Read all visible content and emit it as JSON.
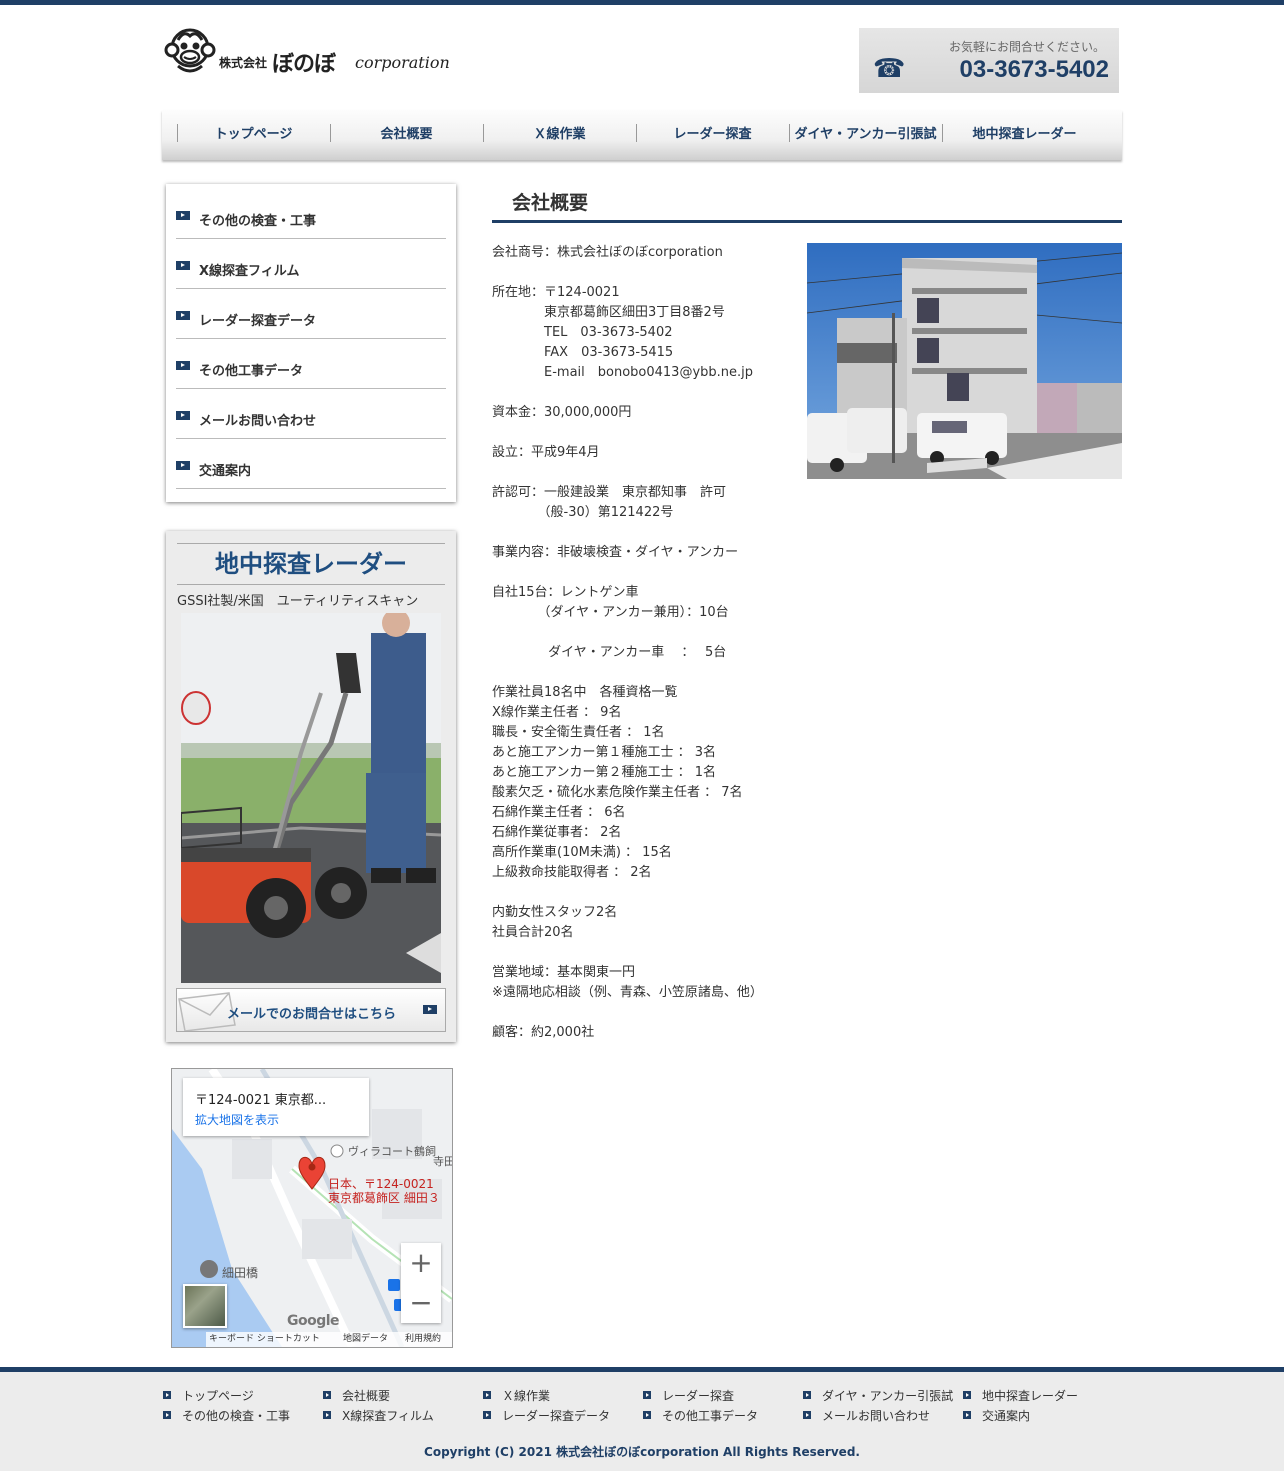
{
  "header": {
    "logo_prefix": "株式会社",
    "logo_name": "ぼのぼ",
    "logo_suffix": "corporation",
    "contact_lead": "お気軽にお問合せください。",
    "phone": "03-3673-5402"
  },
  "gnav": [
    "トップページ",
    "会社概要",
    "Ｘ線作業",
    "レーダー探査",
    "ダイヤ・アンカー引張試",
    "地中探査レーダー"
  ],
  "sidenav": [
    "その他の検査・工事",
    "X線探査フィルム",
    "レーダー探査データ",
    "その他工事データ",
    "メールお問い合わせ",
    "交通案内"
  ],
  "radar_box": {
    "title": "地中探査レーダー",
    "subtitle": "GSSI社製/米国　ユーティリティスキャン",
    "mail_button": "メールでのお問合せはこちら"
  },
  "map": {
    "address": "〒124-0021 東京都...",
    "enlarge_link": "拡大地図を表示",
    "pin_label_1": "日本、〒124-0021",
    "pin_label_2": "東京都葛飾区 細田３",
    "poi_1": "ヴィラコート鶴飼",
    "poi_2": "寺田",
    "poi_3": "細田橋",
    "zoom_in": "+",
    "zoom_out": "−",
    "google": "Google",
    "attr_1": "キーボード ショートカット",
    "attr_2": "地図データ",
    "attr_3": "利用規約"
  },
  "main": {
    "title": "会社概要",
    "lines": [
      "会社商号：株式会社ぼのぼcorporation",
      "",
      "所在地：〒124-0021",
      "　　　　東京都葛飾区細田3丁目8番2号",
      "　　　　TEL　03-3673-5402",
      "　　　　FAX　03-3673-5415",
      "　　　　E-mail　bonobo0413@ybb.ne.jp",
      "",
      "資本金：30,000,000円",
      "",
      "設立：平成9年4月",
      "",
      "許認可：一般建設業　東京都知事　許可",
      "　　　　（般-30）第121422号",
      "",
      "事業内容：非破壊検査・ダイヤ・アンカー",
      "",
      "自社15台：レントゲン車",
      "　　　　（ダイヤ・アンカー兼用）：10台",
      "",
      "　　　　 ダイヤ・アンカー車　 ：　 5台",
      "",
      "作業社員18名中　各種資格一覧",
      "X線作業主任者 ： 9名",
      "職長・安全衛生責任者 ： 1名",
      "あと施工アンカー第１種施工士 ： 3名",
      "あと施工アンカー第２種施工士 ： 1名",
      "酸素欠乏・硫化水素危険作業主任者 ： 7名",
      "石綿作業主任者 ： 6名",
      "石綿作業従事者： 2名",
      "高所作業車(10M未満) ： 15名",
      "上級救命技能取得者 ： 2名",
      "",
      "内勤女性スタッフ2名",
      "社員合計20名",
      "",
      "営業地域：基本関東一円",
      "※遠隔地応相談（例、青森、小笠原諸島、他）",
      "",
      "顧客：約2,000社"
    ]
  },
  "footer": {
    "row1": [
      "トップページ",
      "会社概要",
      "Ｘ線作業",
      "レーダー探査",
      "ダイヤ・アンカー引張試",
      "地中探査レーダー"
    ],
    "row2": [
      "その他の検査・工事",
      "X線探査フィルム",
      "レーダー探査データ",
      "その他工事データ",
      "メールお問い合わせ",
      "交通案内"
    ],
    "copyright": "Copyright (C) 2021 株式会社ぼのぼcorporation All Rights Reserved."
  },
  "colors": {
    "brand": "#1f3f66",
    "accent": "#1f4e80"
  }
}
